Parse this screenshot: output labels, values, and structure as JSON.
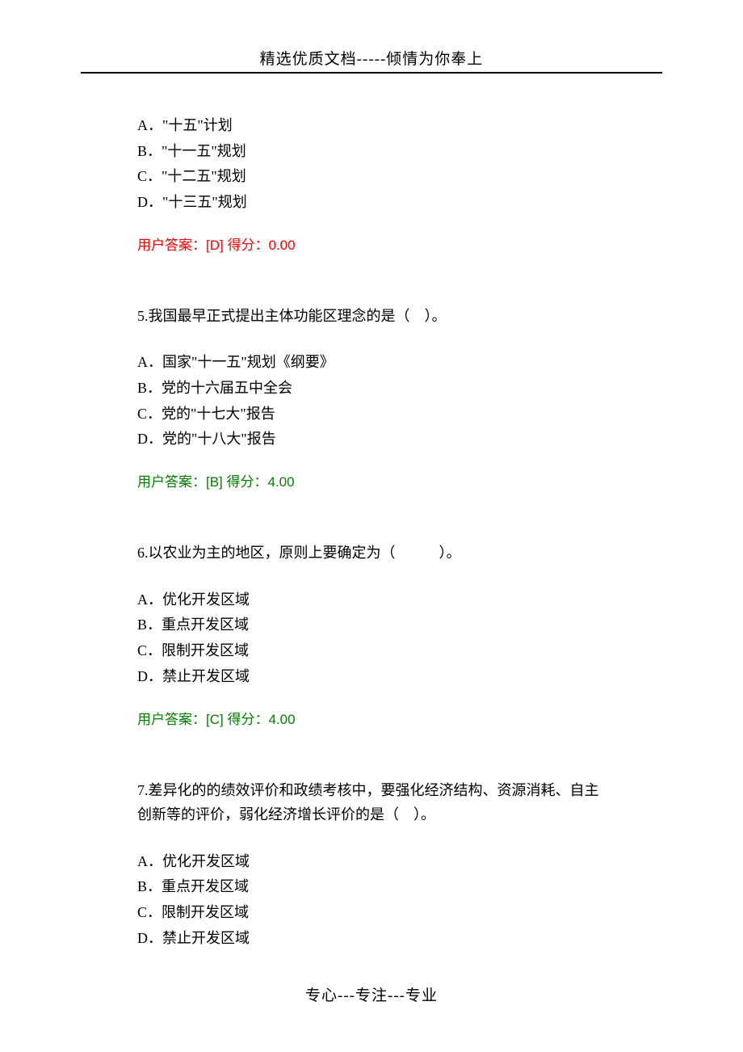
{
  "header": "精选优质文档-----倾情为你奉上",
  "footer": "专心---专注---专业",
  "q4": {
    "options": {
      "a": "A．\"十五\"计划",
      "b": "B．\"十一五\"规划",
      "c": "C．\"十二五\"规划",
      "d": "D．\"十三五\"规划"
    },
    "answer": "用户答案：[D]  得分：0.00"
  },
  "q5": {
    "text": "5.我国最早正式提出主体功能区理念的是（　）。",
    "options": {
      "a": "A．国家\"十一五\"规划《纲要》",
      "b": "B．党的十六届五中全会",
      "c": "C．党的\"十七大\"报告",
      "d": "D．党的\"十八大\"报告"
    },
    "answer": "用户答案：[B]  得分：4.00"
  },
  "q6": {
    "text": "6.以农业为主的地区，原则上要确定为（　　　）。",
    "options": {
      "a": "A．优化开发区域",
      "b": "B．重点开发区域",
      "c": "C．限制开发区域",
      "d": "D．禁止开发区域"
    },
    "answer": "用户答案：[C]  得分：4.00"
  },
  "q7": {
    "text": "7.差异化的的绩效评价和政绩考核中，要强化经济结构、资源消耗、自主创新等的评价，弱化经济增长评价的是（　）。",
    "options": {
      "a": "A．优化开发区域",
      "b": "B．重点开发区域",
      "c": "C．限制开发区域",
      "d": "D．禁止开发区域"
    }
  }
}
